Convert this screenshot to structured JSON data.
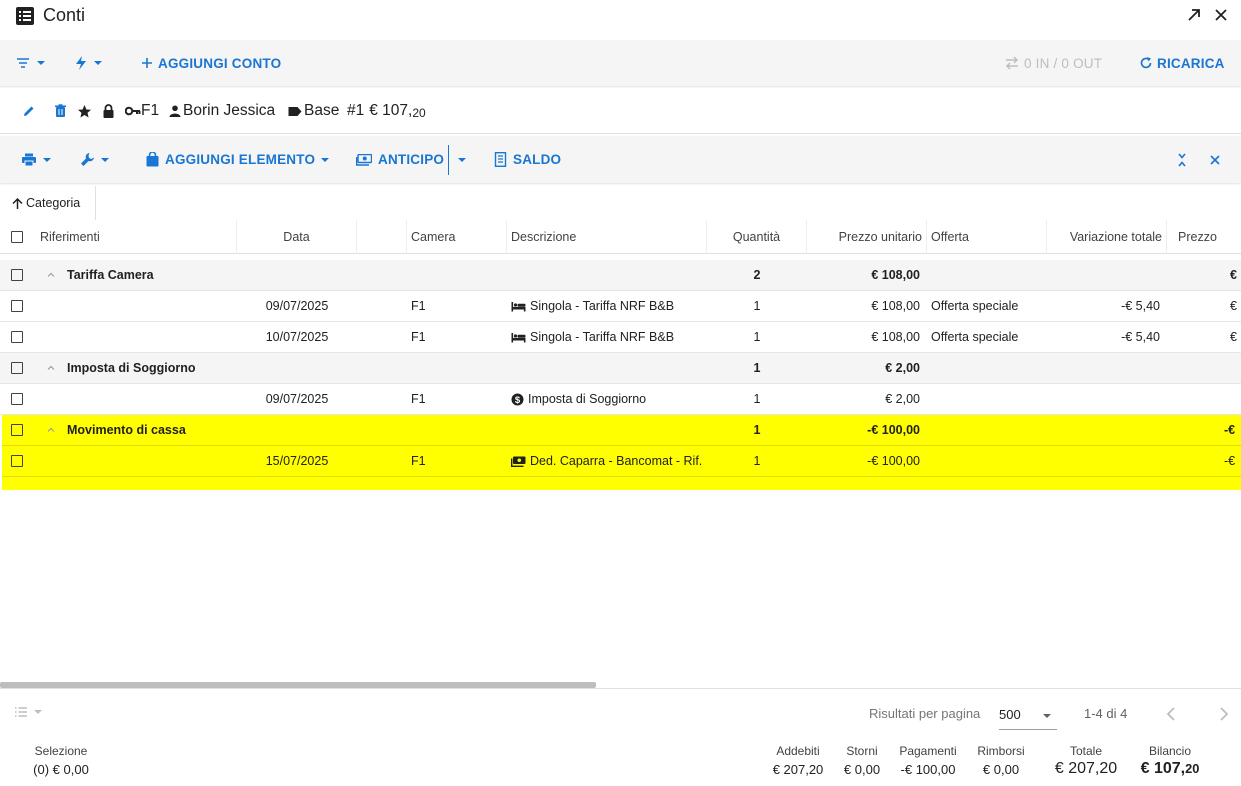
{
  "window": {
    "title": "Conti",
    "icon": "list-box-icon"
  },
  "toolbar": {
    "add_account": "AGGIUNGI CONTO",
    "io_status": "0 IN / 0 OUT",
    "reload": "RICARICA"
  },
  "account": {
    "room": "F1",
    "guest": "Borin Jessica",
    "tag": "Base",
    "number": "#1",
    "amount_int": "€ 107,",
    "amount_dec": "20"
  },
  "toolbar2": {
    "add_item": "AGGIUNGI ELEMENTO",
    "deposit": "ANTICIPO",
    "balance": "SALDO"
  },
  "grouping": {
    "chip": "Categoria"
  },
  "columns": [
    "Riferimenti",
    "Data",
    "",
    "Camera",
    "Descrizione",
    "Quantità",
    "Prezzo unitario",
    "Offerta",
    "Variazione totale",
    "Prezzo"
  ],
  "rows": [
    {
      "type": "group",
      "name": "Tariffa Camera",
      "qty": "2",
      "price": "€ 108,00",
      "total": "€"
    },
    {
      "type": "item",
      "date": "09/07/2025",
      "room": "F1",
      "icon": "bed-icon",
      "desc": "Singola - Tariffa NRF B&B",
      "qty": "1",
      "price": "€ 108,00",
      "offer": "Offerta speciale",
      "variation": "-€ 5,40",
      "total": "€"
    },
    {
      "type": "item",
      "date": "10/07/2025",
      "room": "F1",
      "icon": "bed-icon",
      "desc": "Singola - Tariffa NRF B&B",
      "qty": "1",
      "price": "€ 108,00",
      "offer": "Offerta speciale",
      "variation": "-€ 5,40",
      "total": "€"
    },
    {
      "type": "group",
      "name": "Imposta di Soggiorno",
      "qty": "1",
      "price": "€ 2,00",
      "total": ""
    },
    {
      "type": "item",
      "date": "09/07/2025",
      "room": "F1",
      "icon": "dollar-circle-icon",
      "desc": "Imposta di Soggiorno",
      "qty": "1",
      "price": "€ 2,00",
      "offer": "",
      "variation": "",
      "total": ""
    },
    {
      "type": "group",
      "name": "Movimento di cassa",
      "qty": "1",
      "price": "-€ 100,00",
      "total": "-€",
      "highlight": true
    },
    {
      "type": "item",
      "date": "15/07/2025",
      "room": "F1",
      "icon": "cash-icon",
      "desc": "Ded. Caparra - Bancomat - Rif.",
      "qty": "1",
      "price": "-€ 100,00",
      "offer": "",
      "variation": "",
      "total": "-€",
      "highlight": true
    }
  ],
  "pager": {
    "label": "Risultati per pagina",
    "per_page": "500",
    "range": "1-4 di 4"
  },
  "summary": {
    "selection_label": "Selezione",
    "selection_value": "(0) € 0,00",
    "charges_label": "Addebiti",
    "charges_value": "€ 207,20",
    "reversals_label": "Storni",
    "reversals_value": "€ 0,00",
    "payments_label": "Pagamenti",
    "payments_value": "-€ 100,00",
    "refunds_label": "Rimborsi",
    "refunds_value": "€ 0,00",
    "total_label": "Totale",
    "total_value": "€ 207,20",
    "balance_label": "Bilancio",
    "balance_int": "€ 107,",
    "balance_dec": "20"
  },
  "colors": {
    "accent": "#1976d2",
    "highlight": "#ffff00",
    "toolbar_bg": "#f5f5f5"
  }
}
